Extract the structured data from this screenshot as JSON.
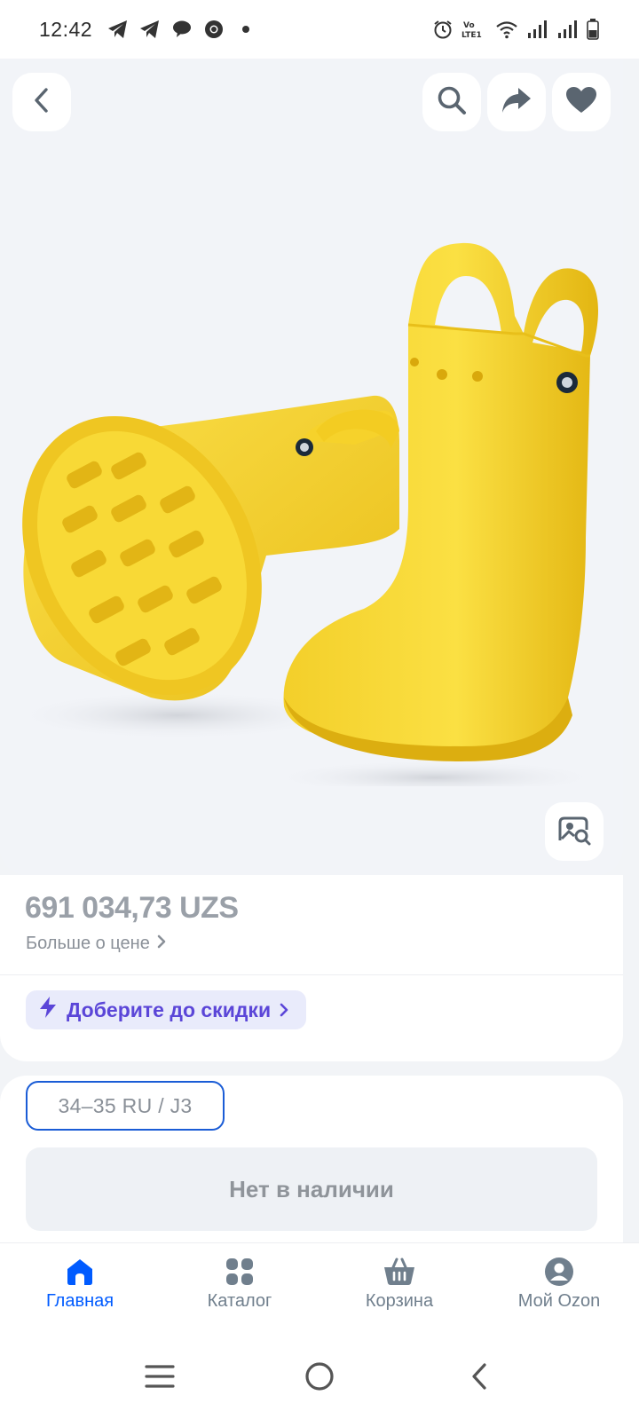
{
  "status_bar": {
    "time": "12:42",
    "left_icons": [
      "telegram-icon",
      "telegram-icon",
      "chat-icon",
      "chrome-icon",
      "dot-icon"
    ],
    "right_icons": [
      "alarm-icon",
      "volte-icon",
      "wifi-icon",
      "signal-icon",
      "signal-icon",
      "battery-icon"
    ],
    "volte_text": "VoLTE1"
  },
  "hero": {
    "icons": [
      "back-icon",
      "search-icon",
      "share-icon",
      "heart-icon",
      "image-search-icon"
    ],
    "boot_color": "#f7d22a"
  },
  "price": {
    "value": "691 034,73 UZS",
    "more_label": "Больше о цене"
  },
  "promo": {
    "label": "Доберите до скидки"
  },
  "variant": {
    "size": "34–35 RU / J3"
  },
  "availability": {
    "label": "Нет в наличии"
  },
  "bottom_nav": {
    "items": [
      {
        "label": "Главная",
        "icon": "home-icon",
        "active": true
      },
      {
        "label": "Каталог",
        "icon": "catalog-icon",
        "active": false
      },
      {
        "label": "Корзина",
        "icon": "basket-icon",
        "active": false
      },
      {
        "label": "Мой Ozon",
        "icon": "profile-icon",
        "active": false
      }
    ]
  },
  "colors": {
    "accent": "#005bff",
    "promo_text": "#5b46d8",
    "promo_bg": "#e9ebfb",
    "price_text": "#9aa0a8"
  }
}
